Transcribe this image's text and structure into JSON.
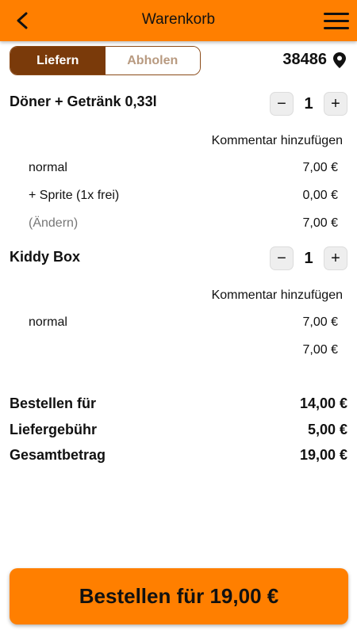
{
  "header": {
    "title": "Warenkorb",
    "back_icon": "chevron-left-icon",
    "menu_icon": "hamburger-menu-icon"
  },
  "delivery_mode": {
    "options": [
      "Liefern",
      "Abholen"
    ],
    "selected": "Liefern"
  },
  "location": {
    "postal_code": "38486",
    "icon": "location-pin-icon"
  },
  "cart": {
    "items": [
      {
        "name": "Döner + Getränk 0,33l",
        "quantity": "1",
        "minus_label": "−",
        "plus_label": "+",
        "comment_label": "Kommentar hinzufügen",
        "lines": [
          {
            "label": "normal",
            "price": "7,00 €"
          },
          {
            "label": "+ Sprite (1x frei)",
            "price": "0,00 €"
          },
          {
            "label": "(Ändern)",
            "price": "7,00 €"
          }
        ]
      },
      {
        "name": "Kiddy Box",
        "quantity": "1",
        "minus_label": "−",
        "plus_label": "+",
        "comment_label": "Kommentar hinzufügen",
        "lines": [
          {
            "label": "normal",
            "price": "7,00 €"
          },
          {
            "label": "",
            "price": "7,00 €"
          }
        ]
      }
    ]
  },
  "summary": {
    "order_for_label": "Bestellen für",
    "order_for_value": "14,00 €",
    "delivery_fee_label": "Liefergebühr",
    "delivery_fee_value": "5,00 €",
    "total_label": "Gesamtbetrag",
    "total_value": "19,00 €"
  },
  "checkout_button": {
    "label": "Bestellen für 19,00 €"
  },
  "colors": {
    "accent": "#ff7f00",
    "toggle_active": "#7a3a0a",
    "toggle_inactive_text": "#b89a80"
  }
}
